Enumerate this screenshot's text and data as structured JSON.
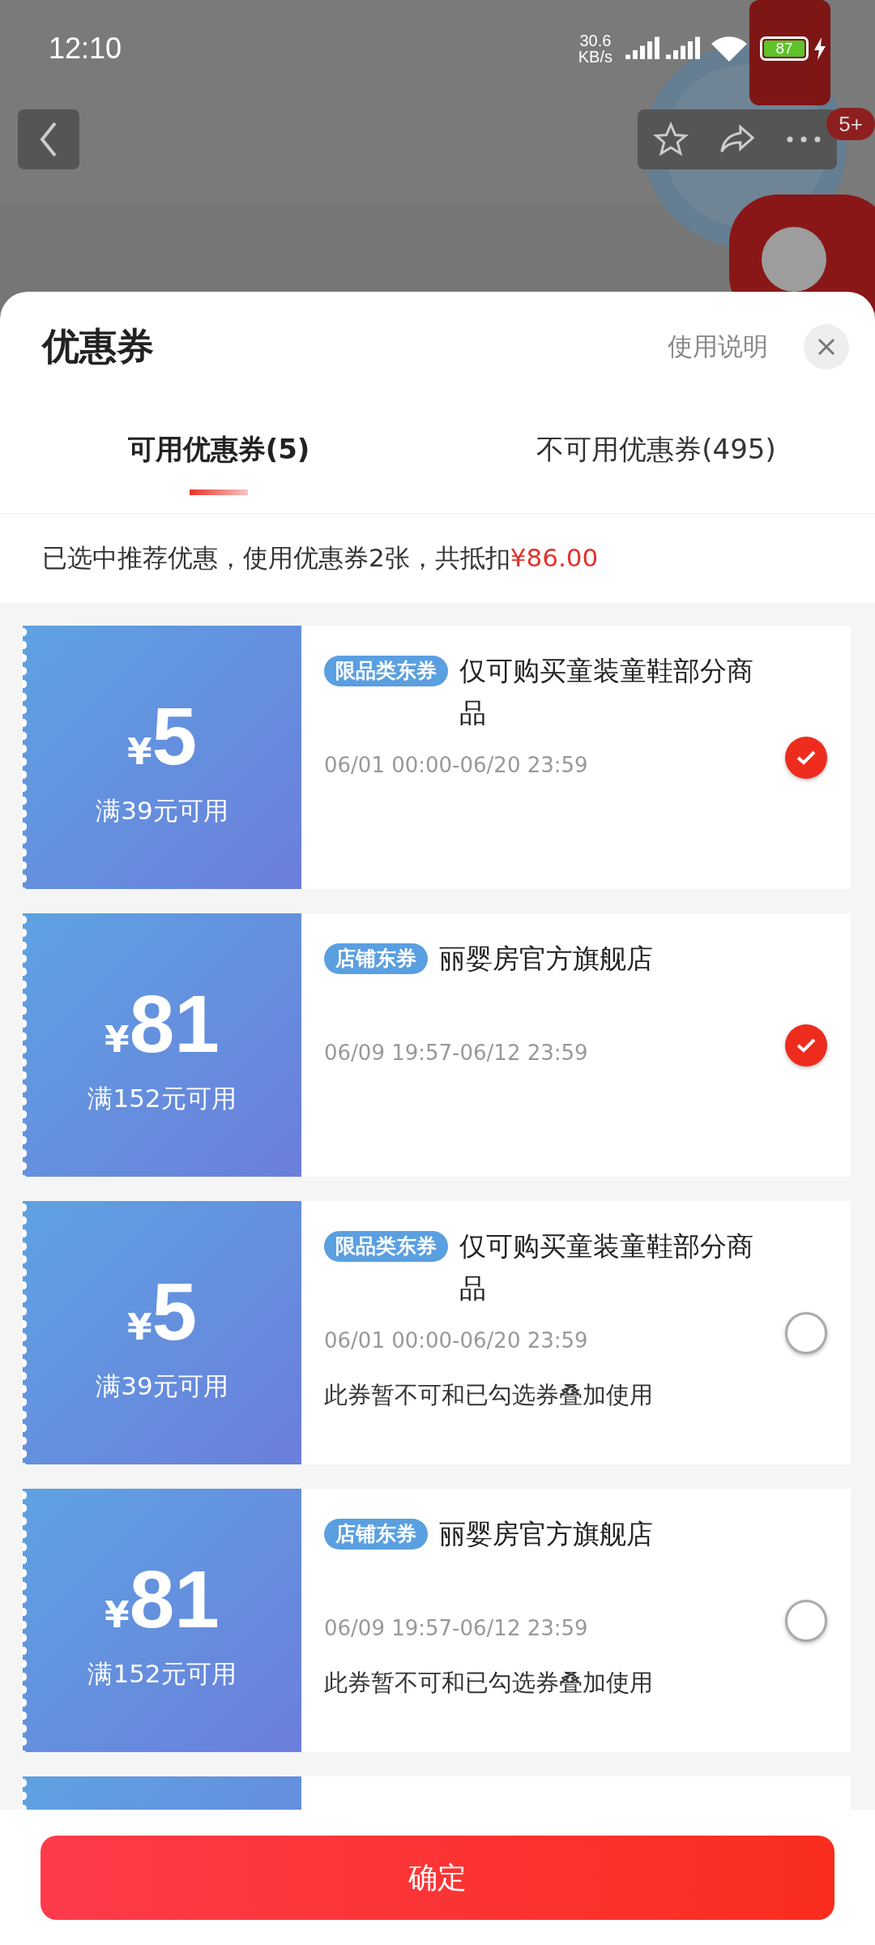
{
  "status_bar": {
    "time": "12:10",
    "net_speed": "30.6",
    "net_unit": "KB/s",
    "battery": "87"
  },
  "nav": {
    "badge": "5+"
  },
  "sheet": {
    "title": "优惠券",
    "help": "使用说明",
    "tabs": [
      {
        "label": "可用优惠券(5)",
        "selected": true
      },
      {
        "label": "不可用优惠券(495)",
        "selected": false
      }
    ],
    "summary": {
      "text": "已选中推荐优惠，使用优惠券2张，共抵扣",
      "amount": "¥86.00"
    }
  },
  "coupons": [
    {
      "currency": "¥",
      "amount": "5",
      "condition": "满39元可用",
      "tag": "限品类东券",
      "title": "仅可购买童装童鞋部分商品",
      "validity": "06/01 00:00-06/20 23:59",
      "selected": true
    },
    {
      "currency": "¥",
      "amount": "81",
      "condition": "满152元可用",
      "tag": "店铺东券",
      "title": "丽婴房官方旗舰店",
      "validity": "06/09 19:57-06/12 23:59",
      "selected": true
    },
    {
      "currency": "¥",
      "amount": "5",
      "condition": "满39元可用",
      "tag": "限品类东券",
      "title": "仅可购买童装童鞋部分商品",
      "validity": "06/01 00:00-06/20 23:59",
      "note": "此券暂不可和已勾选券叠加使用",
      "selected": false
    },
    {
      "currency": "¥",
      "amount": "81",
      "condition": "满152元可用",
      "tag": "店铺东券",
      "title": "丽婴房官方旗舰店",
      "validity": "06/09 19:57-06/12 23:59",
      "note": "此券暂不可和已勾选券叠加使用",
      "selected": false
    }
  ],
  "confirm": "确定"
}
